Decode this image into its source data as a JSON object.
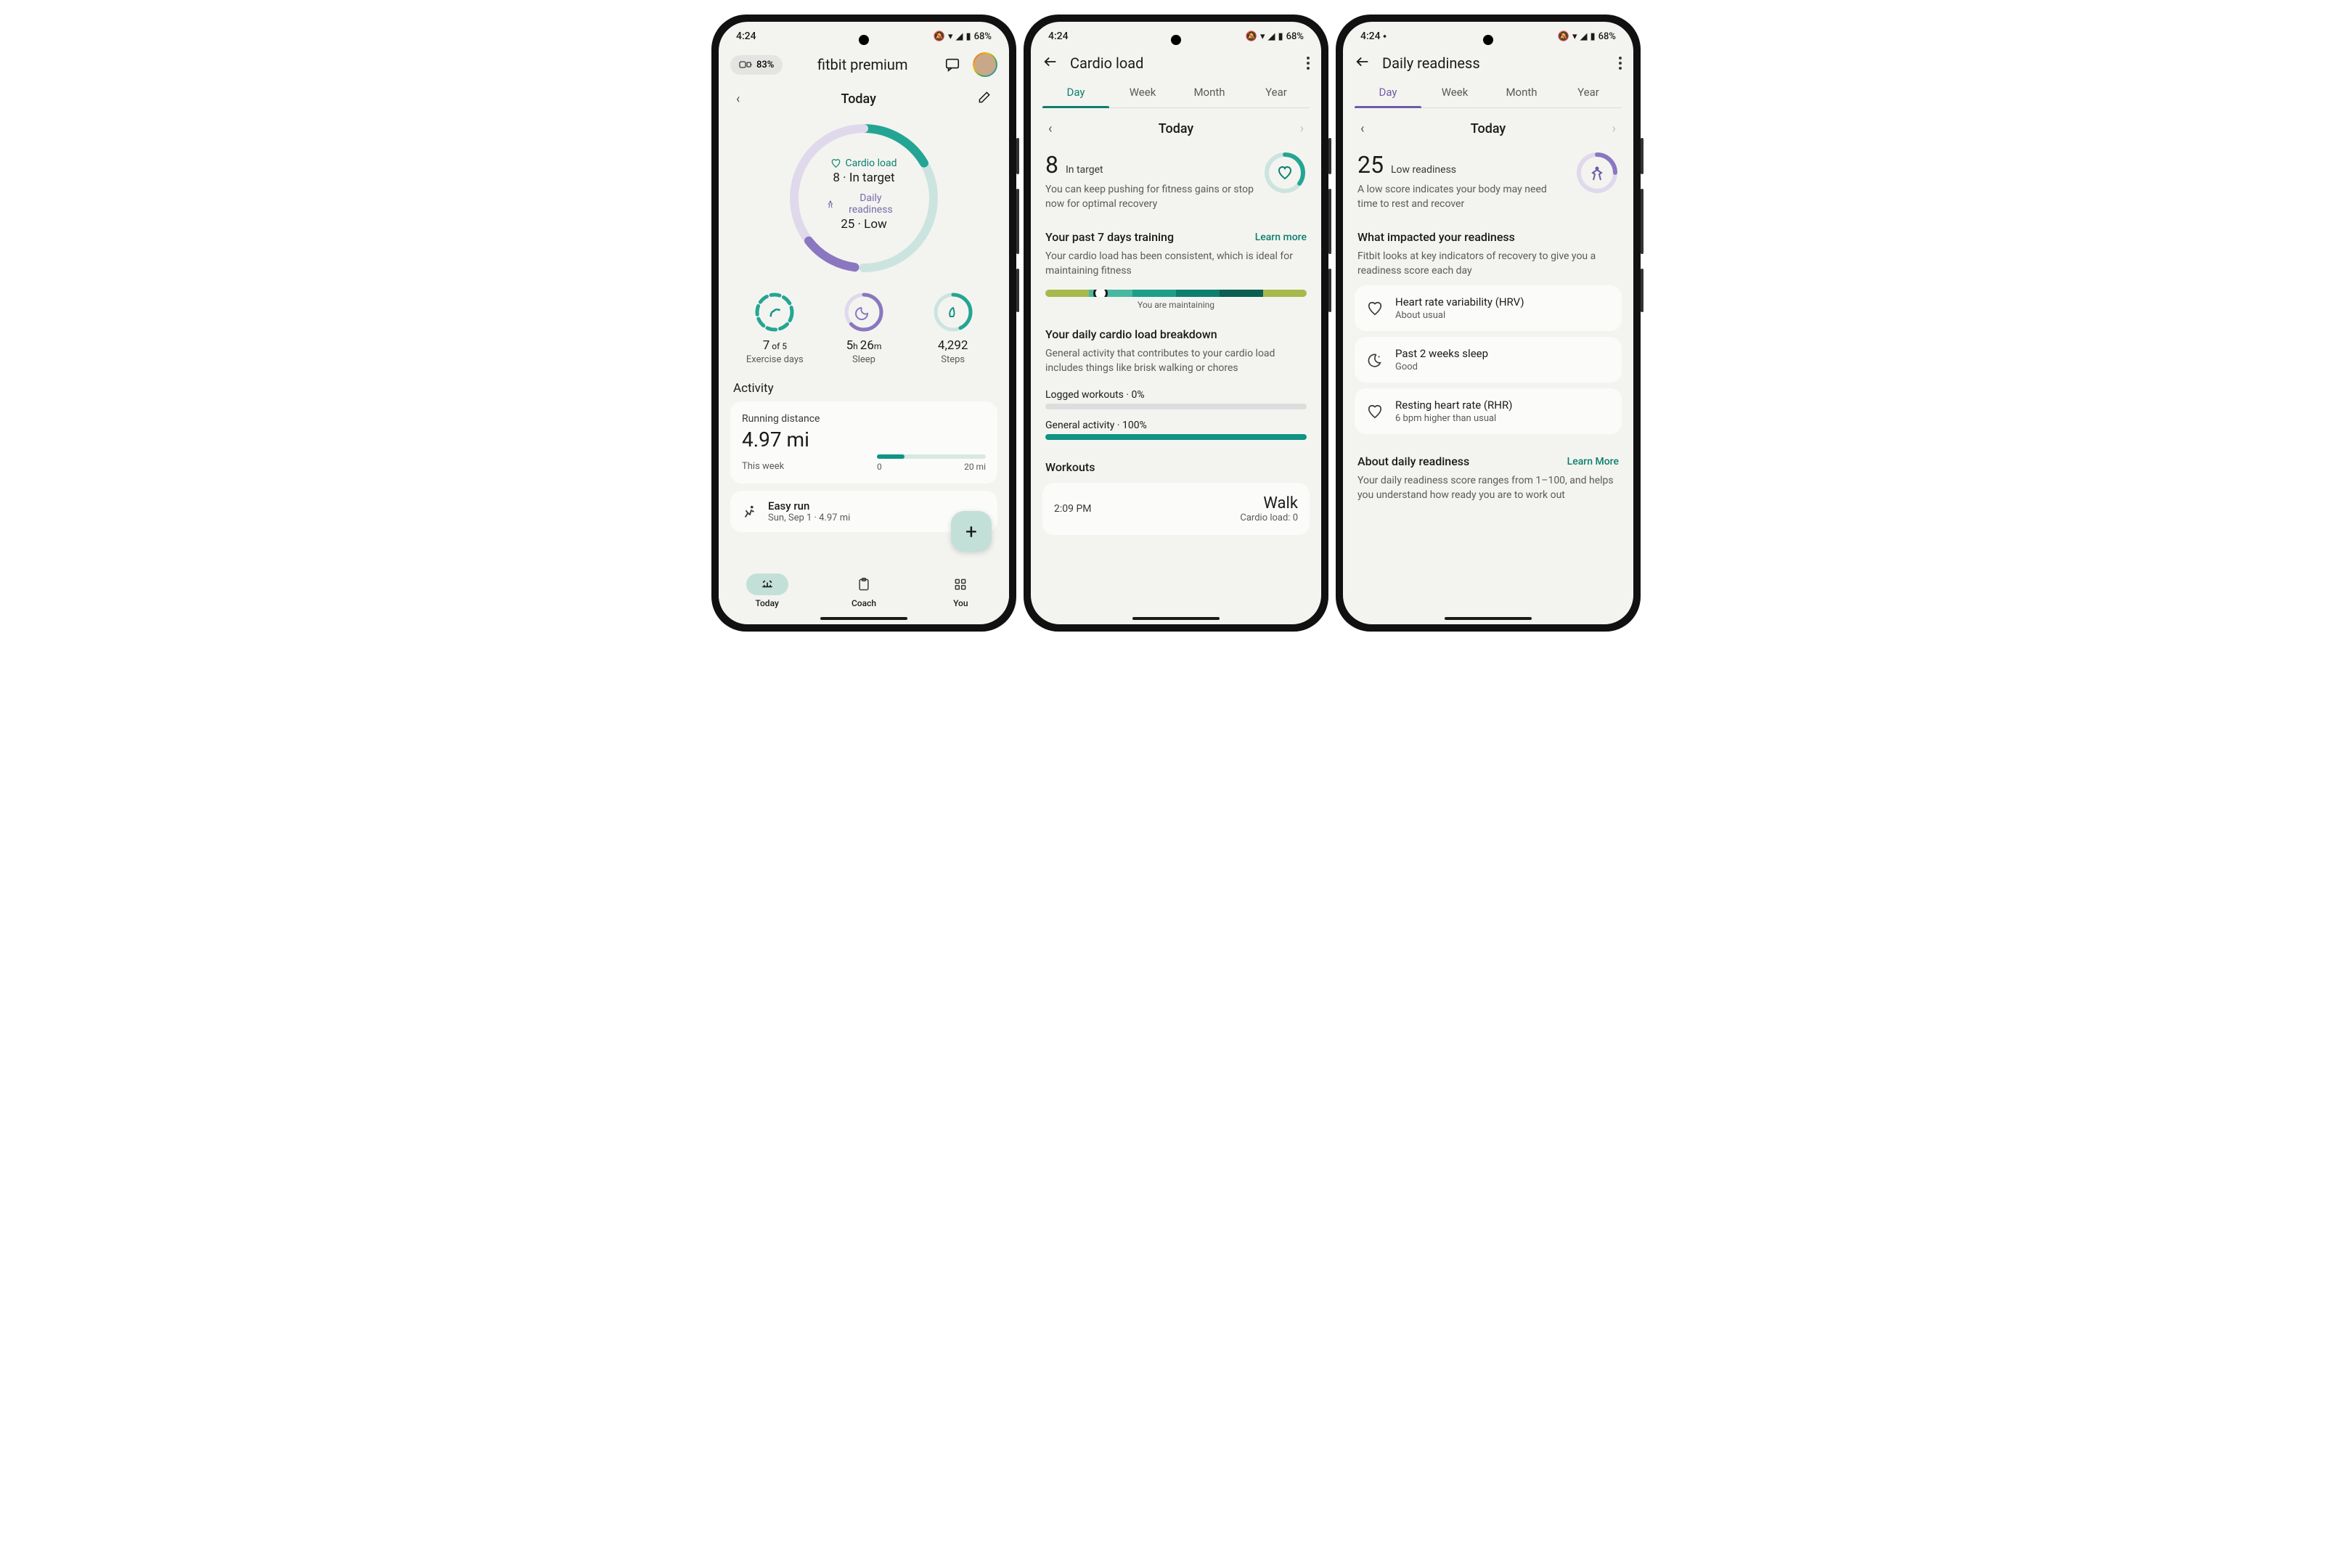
{
  "status": {
    "time": "4:24",
    "time3_extra": "⬩",
    "battery": "68%",
    "signal_icons": "🔕 ▼ ◢ ▮"
  },
  "phone1": {
    "device_battery": "83%",
    "app_title": "fitbit premium",
    "date_label": "Today",
    "cardio": {
      "label": "Cardio load",
      "value": "8 · In target"
    },
    "readiness": {
      "label": "Daily readiness",
      "value": "25 · Low"
    },
    "stats": {
      "exercise_value": "7",
      "exercise_of": " of 5",
      "exercise_label": "Exercise days",
      "sleep_h": "5",
      "sleep_h_unit": "h ",
      "sleep_m": "26",
      "sleep_m_unit": "m",
      "sleep_label": "Sleep",
      "steps_value": "4,292",
      "steps_label": "Steps"
    },
    "activity_section": "Activity",
    "running": {
      "title": "Running distance",
      "value": "4.97 mi",
      "period": "This week",
      "scale_min": "0",
      "scale_max": "20 mi"
    },
    "easy_run": {
      "name": "Easy run",
      "date": "Sun, Sep 1 · 4.97 mi"
    },
    "nav": {
      "today": "Today",
      "coach": "Coach",
      "you": "You"
    }
  },
  "phone2": {
    "title": "Cardio load",
    "tabs": [
      "Day",
      "Week",
      "Month",
      "Year"
    ],
    "date_label": "Today",
    "score": "8",
    "score_status": "In target",
    "score_desc": "You can keep pushing for fitness gains or stop now for optimal recovery",
    "past7_title": "Your past 7 days training",
    "learn_more": "Learn more",
    "past7_desc": "Your cardio load has been consistent, which is ideal for maintaining fitness",
    "maintaining": "You are maintaining",
    "breakdown_title": "Your daily cardio load breakdown",
    "breakdown_desc": "General activity that contributes to your cardio load includes things like brisk walking or chores",
    "logged_label": "Logged workouts · 0%",
    "general_label": "General activity · 100%",
    "workouts_title": "Workouts",
    "workout": {
      "time": "2:09 PM",
      "name": "Walk",
      "detail": "Cardio load: 0"
    }
  },
  "phone3": {
    "title": "Daily readiness",
    "tabs": [
      "Day",
      "Week",
      "Month",
      "Year"
    ],
    "date_label": "Today",
    "score": "25",
    "score_status": "Low readiness",
    "score_desc": "A low score indicates your body may need time to rest and recover",
    "impact_title": "What impacted your readiness",
    "impact_desc": "Fitbit looks at key indicators of recovery to give you a readiness score each day",
    "factors": {
      "hrv_title": "Heart rate variability (HRV)",
      "hrv_sub": "About usual",
      "sleep_title": "Past 2 weeks sleep",
      "sleep_sub": "Good",
      "rhr_title": "Resting heart rate (RHR)",
      "rhr_sub": "6 bpm higher than usual"
    },
    "about_title": "About daily readiness",
    "learn_more": "Learn More",
    "about_desc": "Your daily readiness score ranges from 1–100, and helps you understand how ready you are to work out"
  },
  "chart_data": [
    {
      "type": "gauge",
      "title": "Today ring",
      "series": [
        {
          "name": "Cardio load",
          "value": 8,
          "status": "In target",
          "color": "#24a594"
        },
        {
          "name": "Daily readiness",
          "value": 25,
          "max": 100,
          "status": "Low",
          "color": "#8a77c0"
        }
      ]
    },
    {
      "type": "bar",
      "title": "Running distance (this week)",
      "categories": [
        "This week"
      ],
      "values": [
        4.97
      ],
      "xlabel": "",
      "ylabel": "mi",
      "ylim": [
        0,
        20
      ]
    },
    {
      "type": "gauge",
      "title": "Cardio load score",
      "values": [
        8
      ],
      "status": "In target"
    },
    {
      "type": "bar",
      "title": "Daily cardio load breakdown",
      "categories": [
        "Logged workouts",
        "General activity"
      ],
      "values": [
        0,
        100
      ],
      "ylabel": "%",
      "ylim": [
        0,
        100
      ]
    },
    {
      "type": "gauge",
      "title": "Daily readiness score",
      "values": [
        25
      ],
      "ylim": [
        1,
        100
      ],
      "status": "Low readiness"
    }
  ]
}
